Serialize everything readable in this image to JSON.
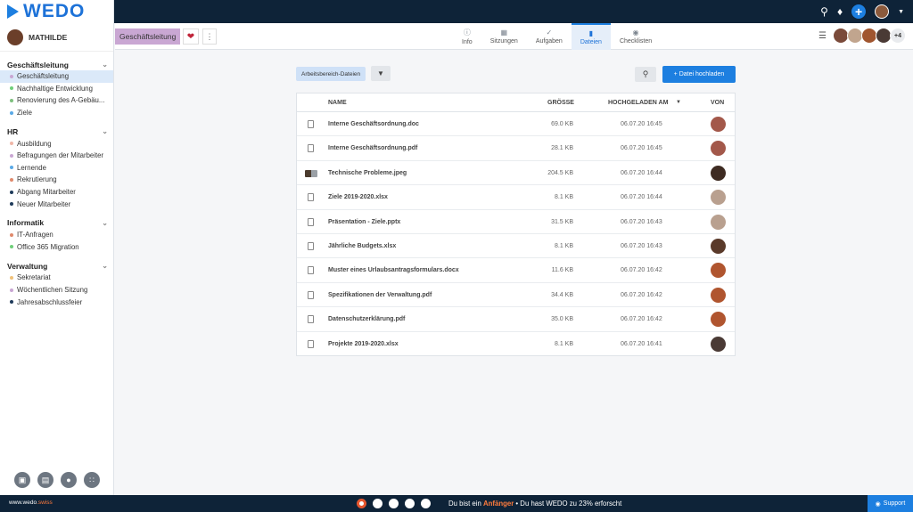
{
  "brand": {
    "name": "WEDO"
  },
  "topbar": {
    "search_icon": "search-icon",
    "bell_icon": "bell-icon",
    "add_icon": "plus-icon"
  },
  "user": {
    "name": "MATHILDE"
  },
  "sidebar": {
    "groups": [
      {
        "title": "Geschäftsleitung",
        "items": [
          {
            "label": "Geschäftsleitung",
            "color": "#c9a7d3",
            "active": true
          },
          {
            "label": "Nachhaltige Entwicklung",
            "color": "#6fcf7a"
          },
          {
            "label": "Renovierung des A-Gebäu...",
            "color": "#7ec07e"
          },
          {
            "label": "Ziele",
            "color": "#5aa9e6"
          }
        ]
      },
      {
        "title": "HR",
        "items": [
          {
            "label": "Ausbildung",
            "color": "#f0b7a8"
          },
          {
            "label": "Befragungen der Mitarbeiter",
            "color": "#c9a7d3"
          },
          {
            "label": "Lernende",
            "color": "#5aa9e6"
          },
          {
            "label": "Rekrutierung",
            "color": "#e08a6c"
          },
          {
            "label": "Abgang Mitarbeiter",
            "color": "#1e3a5a"
          },
          {
            "label": "Neuer Mitarbeiter",
            "color": "#1e3a5a"
          }
        ]
      },
      {
        "title": "Informatik",
        "items": [
          {
            "label": "IT-Anfragen",
            "color": "#e08a6c"
          },
          {
            "label": "Office 365 Migration",
            "color": "#6fcf7a"
          }
        ]
      },
      {
        "title": "Verwaltung",
        "items": [
          {
            "label": "Sekretariat",
            "color": "#f0c27a"
          },
          {
            "label": "Wöchentlichen Sitzung",
            "color": "#c9a7d3"
          },
          {
            "label": "Jahresabschlussfeier",
            "color": "#1e3a5a"
          }
        ]
      }
    ]
  },
  "workspace": {
    "tag": "Geschäftsleitung"
  },
  "tabs": [
    {
      "label": "Info",
      "icon": "info-icon"
    },
    {
      "label": "Sitzungen",
      "icon": "calendar-icon"
    },
    {
      "label": "Aufgaben",
      "icon": "check-icon"
    },
    {
      "label": "Dateien",
      "icon": "file-icon",
      "active": true
    },
    {
      "label": "Checklisten",
      "icon": "checklist-icon"
    }
  ],
  "members": {
    "more": "+4"
  },
  "toolbar": {
    "filter_label": "Arbeitsbereich-Dateien",
    "upload_label": "+ Datei hochladen"
  },
  "table": {
    "headers": {
      "name": "NAME",
      "size": "GRÖSSE",
      "uploaded": "HOCHGELADEN AM",
      "by": "VON"
    },
    "rows": [
      {
        "name": "Interne Geschäftsordnung.doc",
        "size": "69.0 KB",
        "date": "06.07.20 16:45",
        "avatar": "#a3584a"
      },
      {
        "name": "Interne Geschäftsordnung.pdf",
        "size": "28.1 KB",
        "date": "06.07.20 16:45",
        "avatar": "#a3584a"
      },
      {
        "name": "Technische Probleme.jpeg",
        "size": "204.5 KB",
        "date": "06.07.20 16:44",
        "avatar": "#3e2b22"
      },
      {
        "name": "Ziele 2019-2020.xlsx",
        "size": "8.1 KB",
        "date": "06.07.20 16:44",
        "avatar": "#b9a08f"
      },
      {
        "name": "Präsentation - Ziele.pptx",
        "size": "31.5 KB",
        "date": "06.07.20 16:43",
        "avatar": "#b9a08f"
      },
      {
        "name": "Jährliche Budgets.xlsx",
        "size": "8.1 KB",
        "date": "06.07.20 16:43",
        "avatar": "#5a3a2a"
      },
      {
        "name": "Muster eines Urlaubsantragsformulars.docx",
        "size": "11.6 KB",
        "date": "06.07.20 16:42",
        "avatar": "#b0552f"
      },
      {
        "name": "Spezifikationen der Verwaltung.pdf",
        "size": "34.4 KB",
        "date": "06.07.20 16:42",
        "avatar": "#b0552f"
      },
      {
        "name": "Datenschutzerklärung.pdf",
        "size": "35.0 KB",
        "date": "06.07.20 16:42",
        "avatar": "#b0552f"
      },
      {
        "name": "Projekte 2019-2020.xlsx",
        "size": "8.1 KB",
        "date": "06.07.20 16:41",
        "avatar": "#4a3a35"
      }
    ]
  },
  "footer": {
    "site_main": "www.wedo",
    "site_suffix": ".swiss",
    "msg_pre": "Du bist ein ",
    "msg_level": "Anfänger",
    "msg_post": " • Du hast WEDO zu 23% erforscht",
    "support": "Support"
  }
}
